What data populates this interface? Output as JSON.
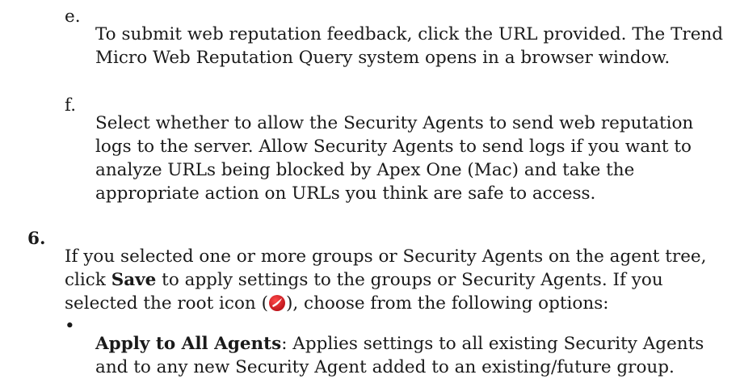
{
  "items": {
    "e": {
      "marker": "e.",
      "text": "To submit web reputation feedback, click the URL provided. The Trend Micro Web Reputation Query system opens in a browser window."
    },
    "f": {
      "marker": "f.",
      "text": "Select whether to allow the Security Agents to send web reputation logs to the server. Allow Security Agents to send logs if you want to analyze URLs being blocked by Apex One (Mac) and take the appropriate action on URLs you think are safe to access."
    },
    "step6": {
      "marker": "6.",
      "text_before": "If you selected one or more groups or Security Agents on the agent tree, click ",
      "bold": "Save",
      "text_middle": " to apply settings to the groups or Security Agents. If you selected the root icon (",
      "text_after": "), choose from the following options:",
      "icon": "root-icon"
    },
    "bullet": {
      "marker": "•",
      "bold": "Apply to All Agents",
      "text": ": Applies settings to all existing Security Agents and to any new Security Agent added to an existing/future group."
    }
  },
  "colors": {
    "text": "#1a1a1a",
    "icon_red": "#d7141c"
  }
}
